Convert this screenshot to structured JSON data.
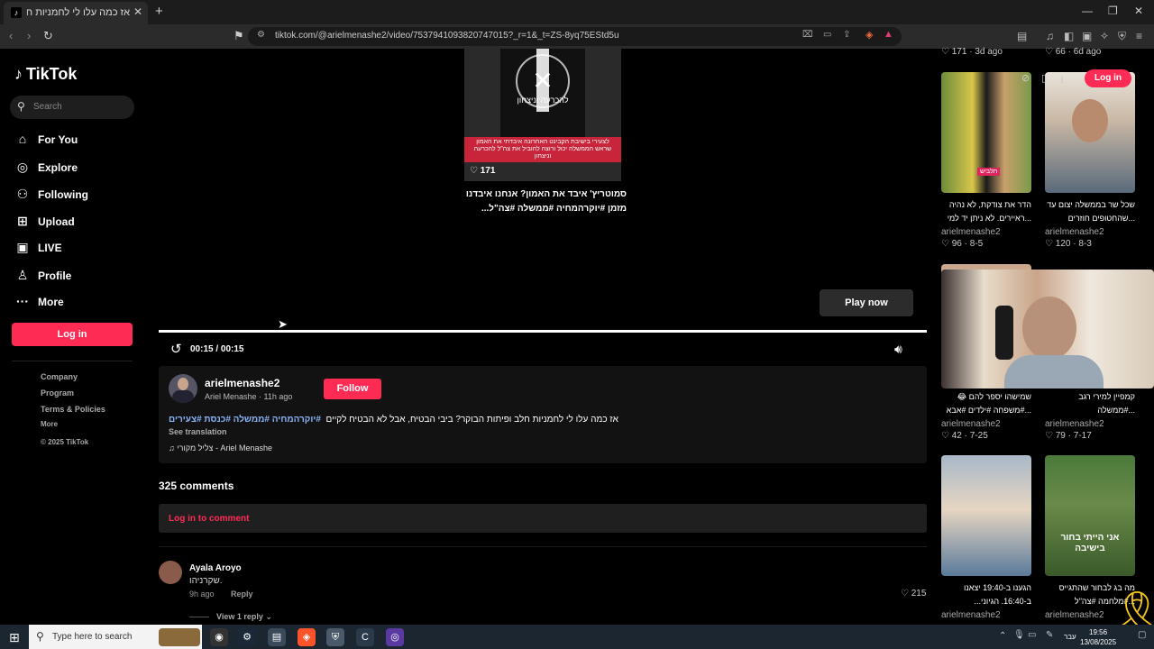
{
  "browser": {
    "tab_title": "אז כמה עלו לי לחמניות חלב ופיתות",
    "url": "tiktok.com/@arielmenashe2/video/7537941093820747015?_r=1&_t=ZS-8yq75EStd5u"
  },
  "sidebar": {
    "logo": "TikTok",
    "search_placeholder": "Search",
    "nav": [
      "For You",
      "Explore",
      "Following",
      "Upload",
      "LIVE",
      "Profile",
      "More"
    ],
    "login": "Log in",
    "footer": [
      "Company",
      "Program",
      "Terms & Policies",
      "More"
    ],
    "copyright": "© 2025 TikTok"
  },
  "preview": {
    "likes": "171",
    "title": "סמוטריץ' איבד את האמון? אנחנו איבדנו מזמן #יוקרהמחיה #ממשלה #צה\"ל...",
    "overlay_text": "להכרעה וניצחון",
    "banner_text": "לצעירי בישיבת הקבינט האחרונה איבדתי את האמון שראש הממשלה יכול ורוצה להוביל את צה\"ל להכרעה וניצחון"
  },
  "player": {
    "play_now": "Play now",
    "time": "00:15 / 00:15",
    "progress": 1.0
  },
  "author": {
    "username": "arielmenashe2",
    "meta": "Ariel Menashe · 11h ago",
    "follow": "Follow",
    "description": "אז כמה עלו לי לחמניות חלב ופיתות הבוקר? ביבי הבטיח, אבל לא הבטיח לקיים",
    "tags": "#יוקרהמחיה #ממשלה #כנסת #צעירים",
    "see_translation": "See translation",
    "sound": "♫ צליל מקורי - Ariel Menashe"
  },
  "comments": {
    "count": "325 comments",
    "login_prompt": "Log in to comment",
    "items": [
      {
        "name": "Ayala Aroyo",
        "text": ".שקרניהו",
        "ago": "9h ago",
        "reply": "Reply",
        "likes": "215",
        "view_replies": "View 1 reply"
      }
    ]
  },
  "right": {
    "top_stats": [
      "171 · 3d ago",
      "66 · 6d ago"
    ],
    "login": "Log in",
    "cards": [
      {
        "title": "הדר את צודקת, לא נהיה ...ראיירים. לא ניתן יד למי",
        "author": "arielmenashe2",
        "stats": "96 · 8-5"
      },
      {
        "title": "שכל שר בממשלה יצום עד ...שהחטופים חוזרים",
        "author": "arielmenashe2",
        "stats": "120 · 8-3"
      },
      {
        "title": "שמישהו יספר להם 😂 ...#משפחה #ילדים #אבא",
        "author": "arielmenashe2",
        "stats": "42 · 7-25"
      },
      {
        "title": "קמפיין למירי רגב ...#ממשלה",
        "author": "arielmenashe2",
        "stats": "79 · 7-17"
      },
      {
        "title": "הגענו ב-19:40 יצאנו ב-16:40. הגיוני...",
        "author": "arielmenashe2",
        "stats": ""
      },
      {
        "title": "מה בג לבחור שהתגייס ...#מלחמה #צה\"ל",
        "author": "arielmenashe2",
        "stats": ""
      }
    ],
    "thumb_labels": [
      "תלביש",
      "אני הייתי בחור בישיבה"
    ]
  },
  "taskbar": {
    "search_placeholder": "Type here to search",
    "time": "19:56",
    "date": "13/08/2025",
    "lang": "עבר"
  }
}
